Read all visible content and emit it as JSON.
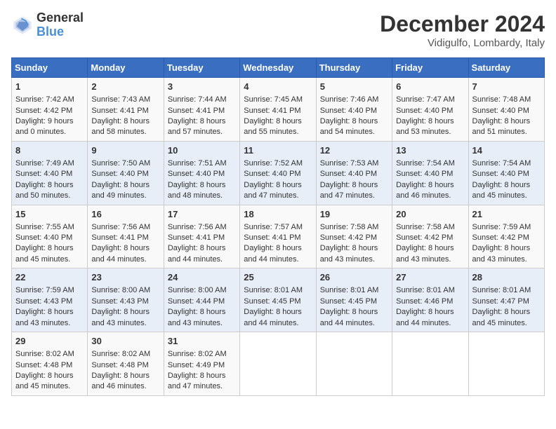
{
  "header": {
    "logo_general": "General",
    "logo_blue": "Blue",
    "title": "December 2024",
    "subtitle": "Vidigulfo, Lombardy, Italy"
  },
  "days_of_week": [
    "Sunday",
    "Monday",
    "Tuesday",
    "Wednesday",
    "Thursday",
    "Friday",
    "Saturday"
  ],
  "weeks": [
    [
      {
        "day": "1",
        "info": "Sunrise: 7:42 AM\nSunset: 4:42 PM\nDaylight: 9 hours\nand 0 minutes."
      },
      {
        "day": "2",
        "info": "Sunrise: 7:43 AM\nSunset: 4:41 PM\nDaylight: 8 hours\nand 58 minutes."
      },
      {
        "day": "3",
        "info": "Sunrise: 7:44 AM\nSunset: 4:41 PM\nDaylight: 8 hours\nand 57 minutes."
      },
      {
        "day": "4",
        "info": "Sunrise: 7:45 AM\nSunset: 4:41 PM\nDaylight: 8 hours\nand 55 minutes."
      },
      {
        "day": "5",
        "info": "Sunrise: 7:46 AM\nSunset: 4:40 PM\nDaylight: 8 hours\nand 54 minutes."
      },
      {
        "day": "6",
        "info": "Sunrise: 7:47 AM\nSunset: 4:40 PM\nDaylight: 8 hours\nand 53 minutes."
      },
      {
        "day": "7",
        "info": "Sunrise: 7:48 AM\nSunset: 4:40 PM\nDaylight: 8 hours\nand 51 minutes."
      }
    ],
    [
      {
        "day": "8",
        "info": "Sunrise: 7:49 AM\nSunset: 4:40 PM\nDaylight: 8 hours\nand 50 minutes."
      },
      {
        "day": "9",
        "info": "Sunrise: 7:50 AM\nSunset: 4:40 PM\nDaylight: 8 hours\nand 49 minutes."
      },
      {
        "day": "10",
        "info": "Sunrise: 7:51 AM\nSunset: 4:40 PM\nDaylight: 8 hours\nand 48 minutes."
      },
      {
        "day": "11",
        "info": "Sunrise: 7:52 AM\nSunset: 4:40 PM\nDaylight: 8 hours\nand 47 minutes."
      },
      {
        "day": "12",
        "info": "Sunrise: 7:53 AM\nSunset: 4:40 PM\nDaylight: 8 hours\nand 47 minutes."
      },
      {
        "day": "13",
        "info": "Sunrise: 7:54 AM\nSunset: 4:40 PM\nDaylight: 8 hours\nand 46 minutes."
      },
      {
        "day": "14",
        "info": "Sunrise: 7:54 AM\nSunset: 4:40 PM\nDaylight: 8 hours\nand 45 minutes."
      }
    ],
    [
      {
        "day": "15",
        "info": "Sunrise: 7:55 AM\nSunset: 4:40 PM\nDaylight: 8 hours\nand 45 minutes."
      },
      {
        "day": "16",
        "info": "Sunrise: 7:56 AM\nSunset: 4:41 PM\nDaylight: 8 hours\nand 44 minutes."
      },
      {
        "day": "17",
        "info": "Sunrise: 7:56 AM\nSunset: 4:41 PM\nDaylight: 8 hours\nand 44 minutes."
      },
      {
        "day": "18",
        "info": "Sunrise: 7:57 AM\nSunset: 4:41 PM\nDaylight: 8 hours\nand 44 minutes."
      },
      {
        "day": "19",
        "info": "Sunrise: 7:58 AM\nSunset: 4:42 PM\nDaylight: 8 hours\nand 43 minutes."
      },
      {
        "day": "20",
        "info": "Sunrise: 7:58 AM\nSunset: 4:42 PM\nDaylight: 8 hours\nand 43 minutes."
      },
      {
        "day": "21",
        "info": "Sunrise: 7:59 AM\nSunset: 4:42 PM\nDaylight: 8 hours\nand 43 minutes."
      }
    ],
    [
      {
        "day": "22",
        "info": "Sunrise: 7:59 AM\nSunset: 4:43 PM\nDaylight: 8 hours\nand 43 minutes."
      },
      {
        "day": "23",
        "info": "Sunrise: 8:00 AM\nSunset: 4:43 PM\nDaylight: 8 hours\nand 43 minutes."
      },
      {
        "day": "24",
        "info": "Sunrise: 8:00 AM\nSunset: 4:44 PM\nDaylight: 8 hours\nand 43 minutes."
      },
      {
        "day": "25",
        "info": "Sunrise: 8:01 AM\nSunset: 4:45 PM\nDaylight: 8 hours\nand 44 minutes."
      },
      {
        "day": "26",
        "info": "Sunrise: 8:01 AM\nSunset: 4:45 PM\nDaylight: 8 hours\nand 44 minutes."
      },
      {
        "day": "27",
        "info": "Sunrise: 8:01 AM\nSunset: 4:46 PM\nDaylight: 8 hours\nand 44 minutes."
      },
      {
        "day": "28",
        "info": "Sunrise: 8:01 AM\nSunset: 4:47 PM\nDaylight: 8 hours\nand 45 minutes."
      }
    ],
    [
      {
        "day": "29",
        "info": "Sunrise: 8:02 AM\nSunset: 4:48 PM\nDaylight: 8 hours\nand 45 minutes."
      },
      {
        "day": "30",
        "info": "Sunrise: 8:02 AM\nSunset: 4:48 PM\nDaylight: 8 hours\nand 46 minutes."
      },
      {
        "day": "31",
        "info": "Sunrise: 8:02 AM\nSunset: 4:49 PM\nDaylight: 8 hours\nand 47 minutes."
      },
      null,
      null,
      null,
      null
    ]
  ]
}
